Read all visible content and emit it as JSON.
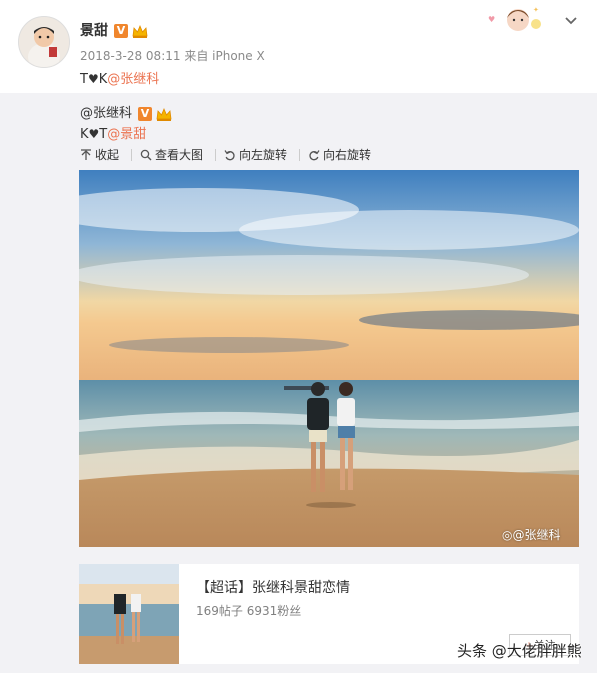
{
  "post": {
    "author": "景甜",
    "verified_badge": "V",
    "timestamp": "2018-3-28 08:11",
    "source": "来自 iPhone X",
    "text_prefix": "T",
    "text_mid": "K",
    "mention": "@张继科"
  },
  "retweet": {
    "author": "@张继科",
    "verified_badge": "V",
    "text_prefix": "K",
    "text_mid": "T",
    "mention": "@景甜",
    "toolbar": {
      "collapse": "收起",
      "view_large": "查看大图",
      "rotate_left": "向左旋转",
      "rotate_right": "向右旋转"
    },
    "photo_watermark": "@张继科"
  },
  "card": {
    "title": "【超话】张继科景甜恋情",
    "stats": "169帖子 6931粉丝",
    "follow_label": "关注"
  },
  "page_watermark": "头条 @大佬胖胖熊",
  "colors": {
    "accent": "#eb7350",
    "badge": "#f0862d",
    "retweet_bg": "#f2f2f5"
  }
}
